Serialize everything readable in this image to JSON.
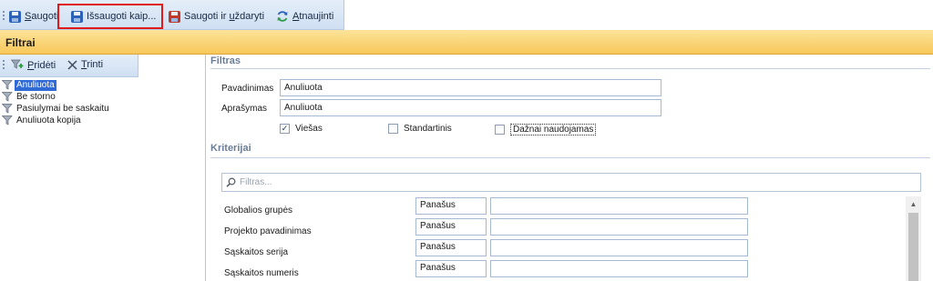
{
  "toolbar": {
    "save": {
      "label": "Saugoti",
      "underline": "S",
      "rest": "augoti",
      "icon": "save-icon"
    },
    "save_as": {
      "label": "Išsaugoti kaip...",
      "icon": "save-as-icon"
    },
    "save_close": {
      "label": "Saugoti ir uždaryti",
      "before": "Saugoti ir ",
      "underline": "u",
      "rest": "ždaryti",
      "icon": "save-close-icon"
    },
    "refresh": {
      "label": "Atnaujinti",
      "underline": "A",
      "rest": "tnaujinti",
      "icon": "refresh-icon"
    }
  },
  "header": {
    "title": "Filtrai"
  },
  "left": {
    "add": {
      "underline": "P",
      "rest": "ridėti",
      "icon": "add-filter-icon"
    },
    "delete": {
      "underline": "T",
      "rest": "rinti",
      "icon": "delete-icon"
    },
    "items": [
      {
        "label": "Anuliuota",
        "selected": true
      },
      {
        "label": "Be storno",
        "selected": false
      },
      {
        "label": "Pasiulymai be saskaitu",
        "selected": false
      },
      {
        "label": "Anuliuota kopija",
        "selected": false
      }
    ]
  },
  "filter": {
    "section": "Filtras",
    "name_label": "Pavadinimas",
    "name_value": "Anuliuota",
    "desc_label": "Aprašymas",
    "desc_value": "Anuliuota",
    "public": {
      "label": "Viešas",
      "checked": true
    },
    "standard": {
      "label": "Standartinis",
      "checked": false
    },
    "frequent": {
      "label": "Dažnai naudojamas",
      "checked": false
    }
  },
  "criteria": {
    "section": "Kriterijai",
    "search_placeholder": "Filtras...",
    "rows": [
      {
        "label": "Globalios grupės",
        "operator": "Panašus",
        "value": ""
      },
      {
        "label": "Projekto pavadinimas",
        "operator": "Panašus",
        "value": ""
      },
      {
        "label": "Sąskaitos serija",
        "operator": "Panašus",
        "value": ""
      },
      {
        "label": "Sąskaitos numeris",
        "operator": "Panašus",
        "value": ""
      }
    ]
  },
  "colors": {
    "accent": "#f8c75a",
    "selection": "#2f6ad6",
    "toolbar": "#cfdff2",
    "highlight": "#e01919"
  }
}
